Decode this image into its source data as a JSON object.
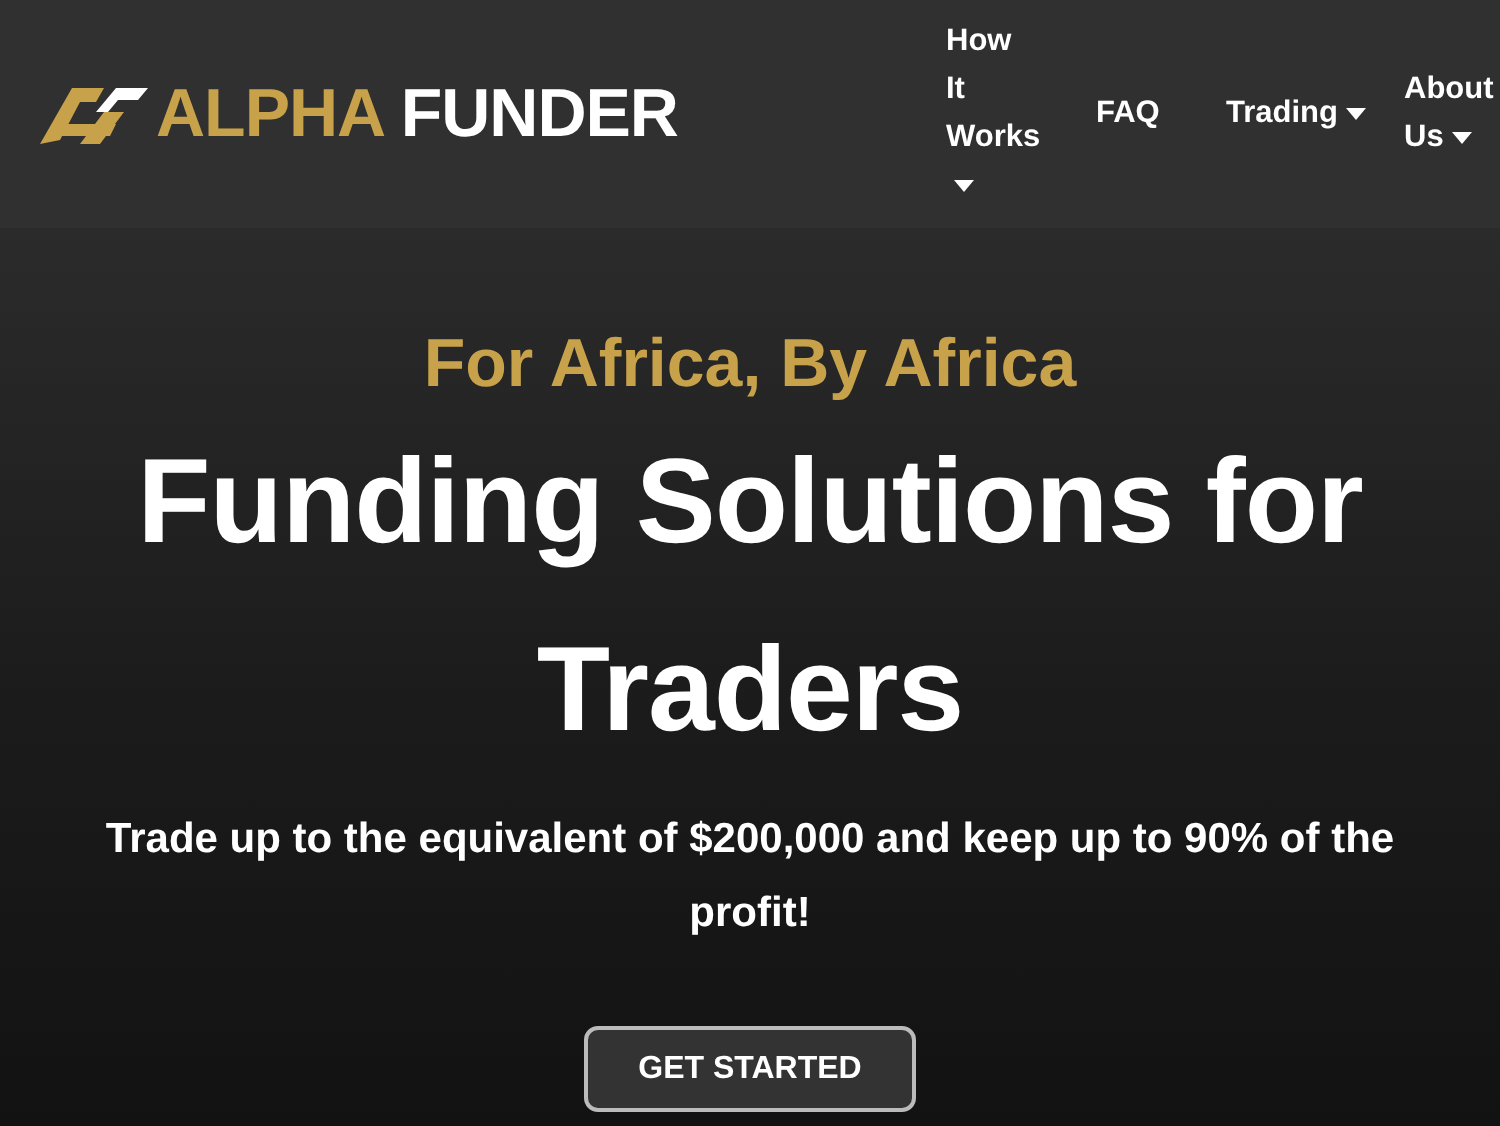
{
  "logo": {
    "brand_first": "ALPHA",
    "brand_second": "FUNDER"
  },
  "nav": [
    {
      "label": "How It Works",
      "dropdown": true
    },
    {
      "label": "FAQ",
      "dropdown": false
    },
    {
      "label": "Trading",
      "dropdown": true
    },
    {
      "label": "About Us",
      "dropdown": true
    }
  ],
  "hero": {
    "tagline": "For Africa, By Africa",
    "headline": "Funding Solutions for Traders",
    "subtitle": "Trade up to the equivalent of $200,000 and keep up to 90% of the profit!",
    "button": "GET STARTED"
  }
}
